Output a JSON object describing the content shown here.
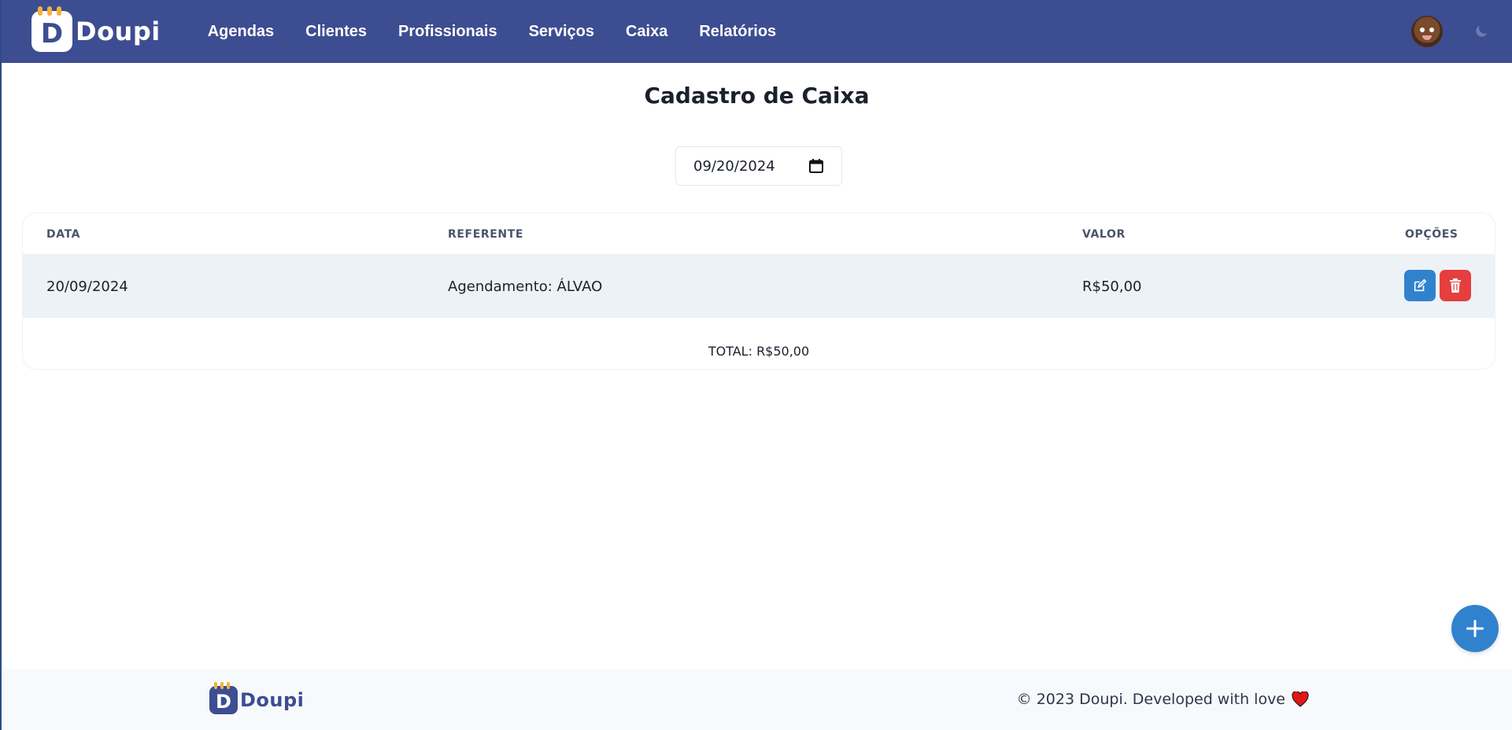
{
  "navbar": {
    "brand": {
      "logo_letter": "D",
      "name": "Doupi"
    },
    "links": [
      {
        "label": "Agendas"
      },
      {
        "label": "Clientes"
      },
      {
        "label": "Profissionais"
      },
      {
        "label": "Serviços"
      },
      {
        "label": "Caixa"
      },
      {
        "label": "Relatórios"
      }
    ],
    "avatar_icon": "user-avatar",
    "theme_icon": "moon-icon"
  },
  "main": {
    "title": "Cadastro de Caixa",
    "date_filter": {
      "value": "09/20/2024",
      "icon": "calendar-icon"
    },
    "table": {
      "columns": [
        "DATA",
        "REFERENTE",
        "VALOR",
        "OPÇÕES"
      ],
      "rows": [
        {
          "data": "20/09/2024",
          "referente": "Agendamento: ÁLVAO",
          "valor": "R$50,00",
          "actions": [
            "edit-icon",
            "trash-icon"
          ]
        }
      ],
      "total": "TOTAL: R$50,00"
    },
    "fab_icon": "plus-icon"
  },
  "footer": {
    "brand": {
      "logo_letter": "D",
      "name": "Doupi"
    },
    "copyright": "© 2023 Doupi. Developed with love",
    "heart_icon": "heart-icon"
  },
  "colors": {
    "navbar": "#3d4d92",
    "accent": "#f2b23b",
    "edit_button": "#3182ce",
    "delete_button": "#e53e3e",
    "row_background": "#edf2f7",
    "footer_background": "#f7fafc"
  }
}
